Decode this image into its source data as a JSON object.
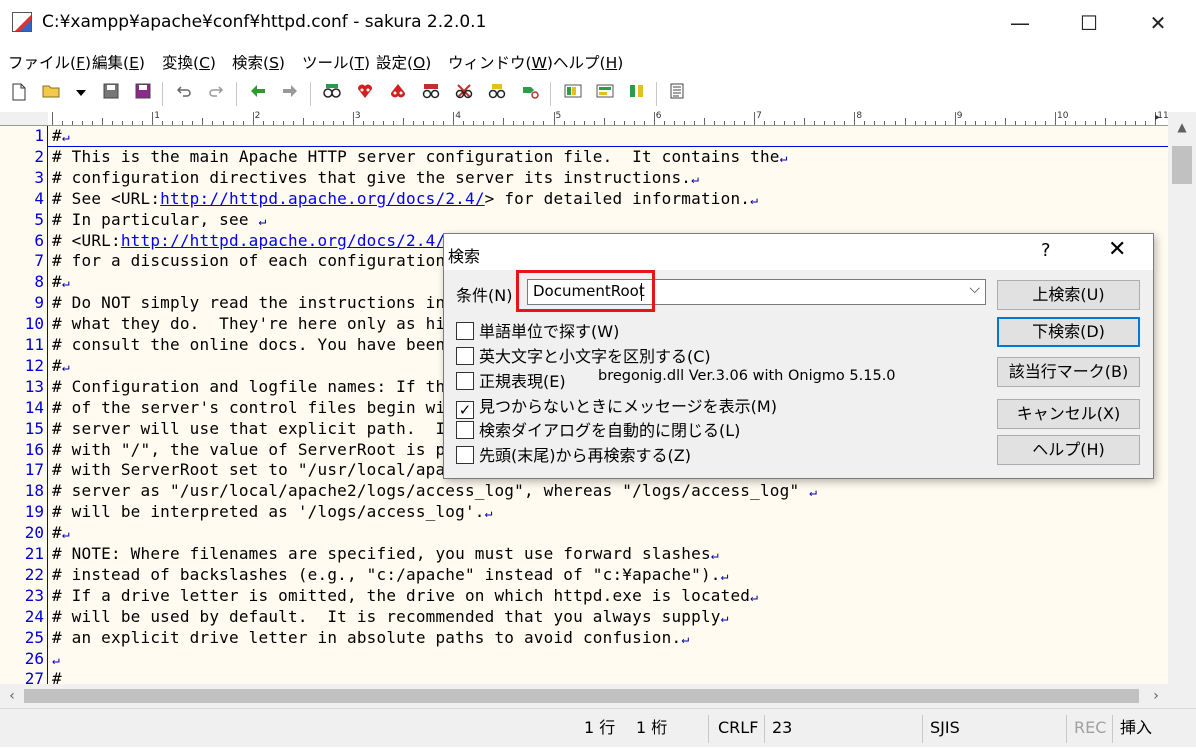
{
  "window": {
    "title": "C:¥xampp¥apache¥conf¥httpd.conf - sakura 2.2.0.1",
    "minimize": "—",
    "maximize": "☐",
    "close": "✕"
  },
  "menu": [
    {
      "label": "ファイル(",
      "key": "F",
      "end": ")"
    },
    {
      "label": "編集(",
      "key": "E",
      "end": ")"
    },
    {
      "label": "変換(",
      "key": "C",
      "end": ")"
    },
    {
      "label": "検索(",
      "key": "S",
      "end": ")"
    },
    {
      "label": "ツール(",
      "key": "T",
      "end": ")"
    },
    {
      "label": "設定(",
      "key": "O",
      "end": ")"
    },
    {
      "label": "ウィンドウ(",
      "key": "W",
      "end": ")"
    },
    {
      "label": "ヘルプ(",
      "key": "H",
      "end": ")"
    }
  ],
  "ruler": {
    "numbers": [
      "1",
      "2",
      "3",
      "4",
      "5",
      "6",
      "7",
      "8",
      "9",
      "10",
      "11"
    ],
    "arrow": "▸"
  },
  "editor": {
    "line_numbers": [
      "1",
      "2",
      "3",
      "4",
      "5",
      "6",
      "7",
      "8",
      "9",
      "10",
      "11",
      "12",
      "13",
      "14",
      "15",
      "16",
      "17",
      "18",
      "19",
      "20",
      "21",
      "22",
      "23",
      "24",
      "25",
      "26",
      "27"
    ],
    "lines": [
      "#",
      "# This is the main Apache HTTP server configuration file.  It contains the",
      "# configuration directives that give the server its instructions.",
      "# See <URL:http://httpd.apache.org/docs/2.4/> for detailed information.",
      "# In particular, see ",
      "# <URL:http://httpd.apache.org/docs/2.4/mod/directives.html>",
      "# for a discussion of each configuration directive.",
      "#",
      "# Do NOT simply read the instructions in here without understanding",
      "# what they do.  They're here only as hints or reminders.  If you are unsure",
      "# consult the online docs. You have been warned.  ",
      "#",
      "# Configuration and logfile names: If the filenames you specify for many",
      "# of the server's control files begin with \"/\" (or \"drive:/\" for Win32), the",
      "# server will use that explicit path.  If the filenames do *not* begin",
      "# with \"/\", the value of ServerRoot is prepended -- so \"logs/access_log\"",
      "# with ServerRoot set to \"/usr/local/apache2\" will be interpreted by the",
      "# server as \"/usr/local/apache2/logs/access_log\", whereas \"/logs/access_log\" ",
      "# will be interpreted as '/logs/access_log'.",
      "#",
      "# NOTE: Where filenames are specified, you must use forward slashes",
      "# instead of backslashes (e.g., \"c:/apache\" instead of \"c:¥apache\").",
      "# If a drive letter is omitted, the drive on which httpd.exe is located",
      "# will be used by default.  It is recommended that you always supply",
      "# an explicit drive letter in absolute paths to avoid confusion.",
      "",
      "#"
    ],
    "eol_mark": "↵",
    "link_url": "http://httpd.apache.org/docs/2.4/"
  },
  "status": {
    "line": "1 行",
    "col": "1 桁",
    "eol": "CRLF",
    "code": "23",
    "encoding": "SJIS",
    "rec": "REC",
    "mode": "挿入"
  },
  "dialog": {
    "title": "検索",
    "help": "?",
    "close": "✕",
    "condition_label": "条件(N)",
    "search_value": "DocumentRoot",
    "dropdown_arrow": "⌵",
    "options": [
      {
        "label": "単語単位で探す(W)",
        "checked": false
      },
      {
        "label": "英大文字と小文字を区別する(C)",
        "checked": false
      },
      {
        "label": "正規表現(E)",
        "checked": false
      },
      {
        "label": "見つからないときにメッセージを表示(M)",
        "checked": true
      },
      {
        "label": "検索ダイアログを自動的に閉じる(L)",
        "checked": false
      },
      {
        "label": "先頭(末尾)から再検索する(Z)",
        "checked": false
      }
    ],
    "regex_info": "bregonig.dll Ver.3.06 with Onigmo 5.15.0",
    "buttons": {
      "search_up": "上検索(U)",
      "search_down": "下検索(D)",
      "mark_lines": "該当行マーク(B)",
      "cancel": "キャンセル(X)",
      "help": "ヘルプ(H)"
    },
    "checkmark": "✓"
  },
  "toolbar": {
    "icons": [
      "new-file",
      "open-folder",
      "dropdown",
      "save",
      "save-all",
      "undo",
      "redo",
      "jump-back",
      "jump-forward",
      "search",
      "search-next",
      "search-prev",
      "replace",
      "incremental",
      "grep",
      "bookmark",
      "tag-jump",
      "outline",
      "compare",
      "macro",
      "settings"
    ]
  }
}
